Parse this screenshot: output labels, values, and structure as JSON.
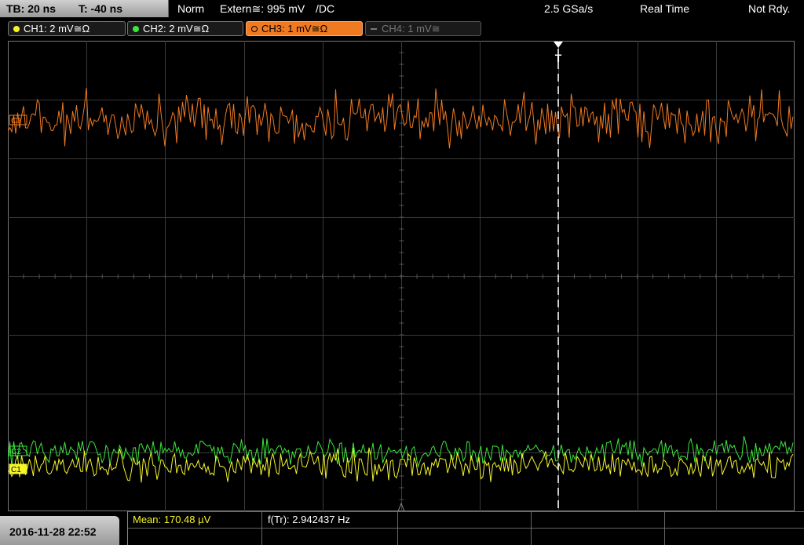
{
  "topbar": {
    "timebase": "TB: 20 ns",
    "trigger_pos": "T: -40 ns",
    "mode": "Norm",
    "trigger_source": "Extern≅: 995 mV",
    "trigger_coupling": "/DC",
    "sample_rate": "2.5 GSa/s",
    "acq_mode": "Real Time",
    "status": "Not Rdy."
  },
  "channels": [
    {
      "label": "CH1: 2 mV≅Ω",
      "color": "#f5f52a",
      "state": "on"
    },
    {
      "label": "CH2: 2 mV≅Ω",
      "color": "#3ce63c",
      "state": "on"
    },
    {
      "label": "CH3: 1 mV≅Ω",
      "color": "#f07a22",
      "state": "active"
    },
    {
      "label": "CH4: 1 mV≅",
      "color": "#777777",
      "state": "off"
    }
  ],
  "markers": {
    "ch3": "C3",
    "ch1": "C1",
    "ch2": "C2",
    "trigger": "T"
  },
  "measurements": {
    "mean_label": "Mean: 170.48 µV",
    "freq_label": "f(Tr): 2.942437 Hz"
  },
  "datetime": "2016-11-28 22:52",
  "colors": {
    "ch1": "#f5f52a",
    "ch2": "#3ce63c",
    "ch3": "#f07a22",
    "grid": "#3a3a3a",
    "mean_text": "#f5f52a"
  }
}
